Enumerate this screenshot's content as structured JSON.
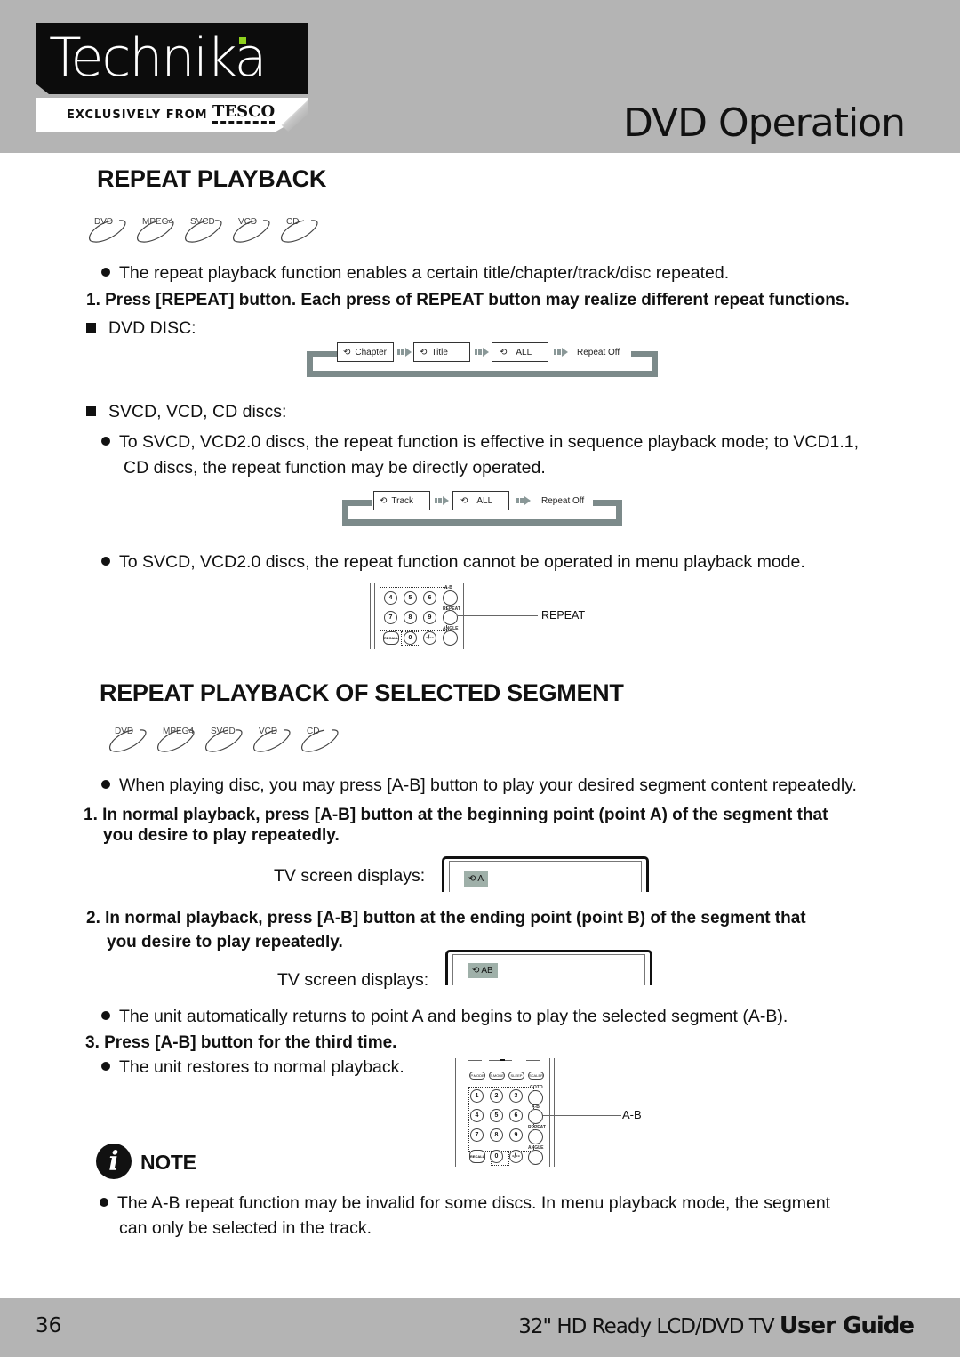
{
  "header": {
    "brand": "Technika",
    "brand_tagline": "EXCLUSIVELY FROM",
    "retailer": "TESCO",
    "page_title": "DVD Operation",
    "brand_accent": "#8fd21e"
  },
  "section1": {
    "heading": "REPEAT PLAYBACK",
    "disc_types": [
      "DVD",
      "MPEG4",
      "SVCD",
      "VCD",
      "CD"
    ],
    "intro": "The repeat playback function enables a certain title/chapter/track/disc repeated.",
    "step1": "1. Press [REPEAT] button. Each press of REPEAT button may realize different repeat functions.",
    "dvd_label": "DVD DISC:",
    "dvd_flow": [
      "Chapter",
      "Title",
      "ALL",
      "Repeat Off"
    ],
    "svcd_label": "SVCD, VCD, CD discs:",
    "svcd_note_line1": "To SVCD, VCD2.0 discs, the repeat function is effective in sequence playback mode; to VCD1.1,",
    "svcd_note_line2": "CD discs, the repeat function may be directly operated.",
    "svcd_flow": [
      "Track",
      "ALL",
      "Repeat Off"
    ],
    "menu_note": "To SVCD, VCD2.0 discs, the repeat function cannot be operated in menu playback mode.",
    "remote_callout": "REPEAT",
    "remote_keys": [
      "4",
      "5",
      "6",
      "7",
      "8",
      "9",
      "RECALL",
      "0",
      "-/--"
    ],
    "remote_labels": [
      "A-B",
      "REPEAT",
      "ANGLE"
    ]
  },
  "section2": {
    "heading": "REPEAT PLAYBACK OF SELECTED SEGMENT",
    "disc_types": [
      "DVD",
      "MPEG4",
      "SVCD",
      "VCD",
      "CD"
    ],
    "intro": "When playing disc, you may press [A-B] button to play your desired segment content repeatedly.",
    "step1_line1": "1. In normal playback, press [A-B] button at the beginning point (point A) of the segment that",
    "step1_line2": "you desire to play repeatedly.",
    "tv_label": "TV screen displays:",
    "tv1_badge": "A",
    "step2_line1": "2. In normal playback, press [A-B] button at the ending point (point B) of the segment that",
    "step2_line2": "you desire to play repeatedly.",
    "tv2_badge": "AB",
    "auto_return": "The unit automatically returns to point A and begins to play the selected segment (A-B).",
    "step3": "3. Press [A-B] button for the third time.",
    "restore": "The unit restores to normal playback.",
    "remote_callout": "A-B",
    "remote_top_keys": [
      "P.MODE",
      "S.MODE",
      "SLEEP",
      "SCALER"
    ],
    "remote_keys": [
      "1",
      "2",
      "3",
      "4",
      "5",
      "6",
      "7",
      "8",
      "9",
      "RECALL",
      "0",
      "-/--"
    ],
    "remote_labels": [
      "GOTO",
      "A-B",
      "REPEAT",
      "ANGLE"
    ]
  },
  "note": {
    "heading": "NOTE",
    "line1": "The A-B repeat function may be invalid for some discs. In menu playback mode, the segment",
    "line2": "can only be selected in the track."
  },
  "footer": {
    "page_number": "36",
    "product": "32\" HD Ready LCD/DVD TV",
    "guide": "User Guide"
  }
}
